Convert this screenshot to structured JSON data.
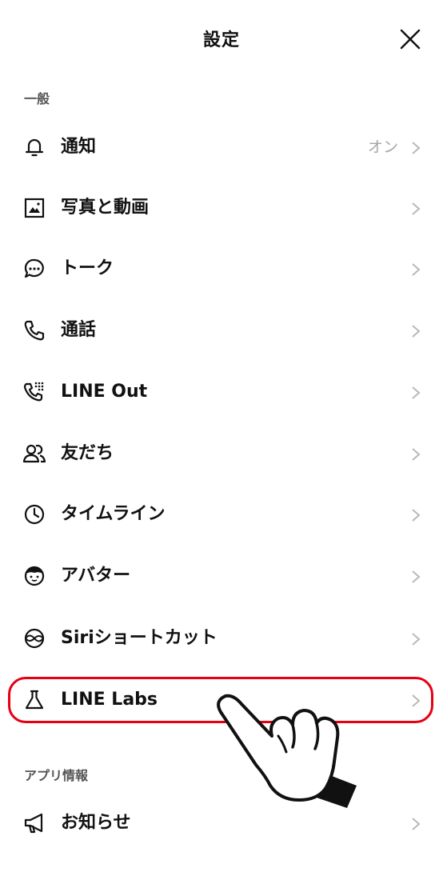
{
  "header": {
    "title": "設定"
  },
  "sections": {
    "general": "一般",
    "app_info": "アプリ情報"
  },
  "menu": {
    "notifications": {
      "label": "通知",
      "value": "オン"
    },
    "photos_videos": {
      "label": "写真と動画"
    },
    "talk": {
      "label": "トーク"
    },
    "calls": {
      "label": "通話"
    },
    "line_out": {
      "label": "LINE Out"
    },
    "friends": {
      "label": "友だち"
    },
    "timeline": {
      "label": "タイムライン"
    },
    "avatar": {
      "label": "アバター"
    },
    "siri": {
      "label": "Siriショートカット"
    },
    "line_labs": {
      "label": "LINE Labs"
    },
    "announcements": {
      "label": "お知らせ"
    }
  },
  "colors": {
    "highlight": "#e60012",
    "chevron": "#b8b8b8",
    "value_text": "#a5a5a5"
  }
}
